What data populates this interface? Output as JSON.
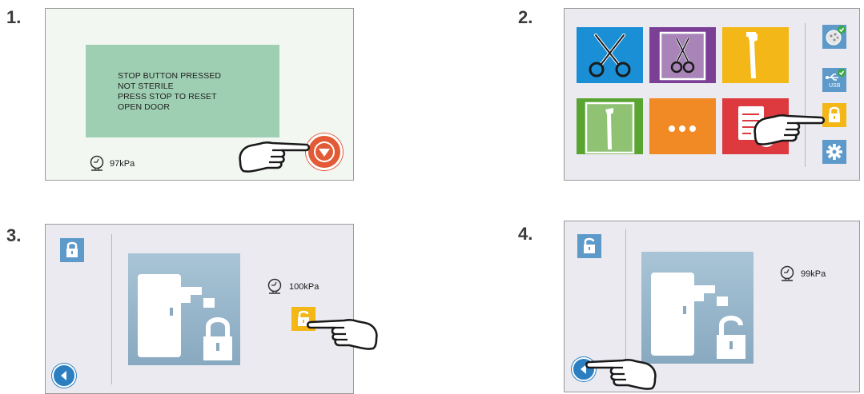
{
  "steps": [
    {
      "number": "1.",
      "message_lines": [
        "STOP BUTTON PRESSED",
        "NOT STERILE",
        "PRESS STOP TO RESET",
        "OPEN DOOR"
      ],
      "pressure": "97kPa",
      "icons": [
        "gauge-icon",
        "stop-down-arrow-icon",
        "pointing-hand-icon"
      ]
    },
    {
      "number": "2.",
      "tiles": [
        "scissors-tile",
        "pouched-instrument-tile",
        "handpiece-tile",
        "pouched-handpiece-tile",
        "more-tile",
        "checklist-tile"
      ],
      "side_buttons": [
        "globe-icon",
        "usb-icon",
        "lock-icon",
        "gear-icon"
      ],
      "usb_label": "USB",
      "colors": {
        "blue": "#1a8fd6",
        "purple": "#7b3f96",
        "yellow": "#f4b718",
        "green": "#5aa432",
        "orange": "#f18a24",
        "red": "#dc3a3f"
      }
    },
    {
      "number": "3.",
      "pressure": "100kPa",
      "icons": [
        "lock-icon",
        "door-locked-icon",
        "unlock-button-icon",
        "back-icon",
        "pointing-hand-icon"
      ]
    },
    {
      "number": "4.",
      "pressure": "99kPa",
      "icons": [
        "unlock-icon",
        "door-unlocked-icon",
        "back-icon",
        "pointing-hand-icon"
      ]
    }
  ]
}
